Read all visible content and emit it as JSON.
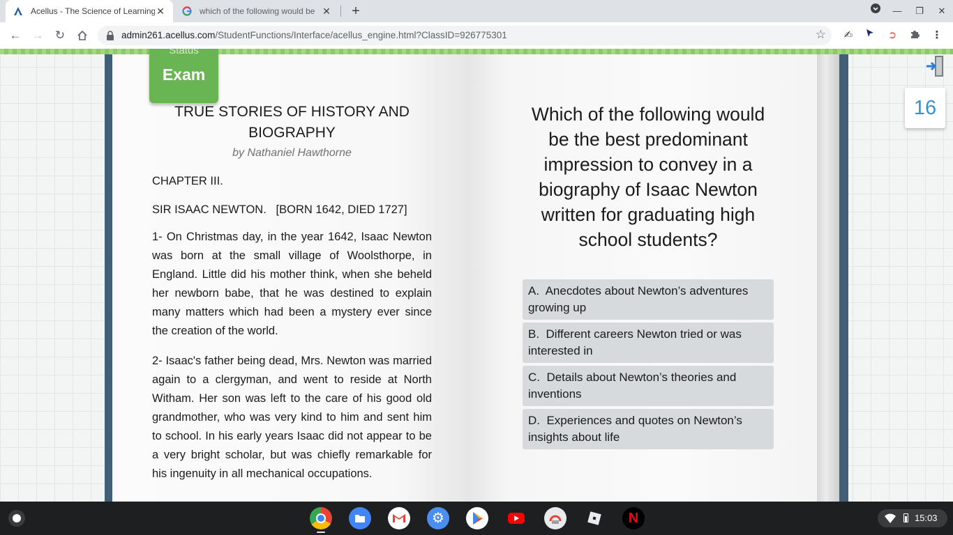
{
  "browser": {
    "tabs": [
      {
        "title": "Acellus - The Science of Learning",
        "favicon": "acellus-logo-icon",
        "active": true
      },
      {
        "title": "which of the following would be",
        "favicon": "google-g-icon",
        "active": false
      }
    ],
    "address": {
      "domain": "admin261.acellus.com",
      "path": "/StudentFunctions/Interface/acellus_engine.html?ClassID=926775301"
    }
  },
  "lesson": {
    "status_label": "Status",
    "mode_label": "Exam",
    "book_title": "TRUE STORIES OF HISTORY AND BIOGRAPHY",
    "byline": "by Nathaniel Hawthorne",
    "chapter": "CHAPTER III.",
    "subject": "SIR ISAAC NEWTON.   [BORN 1642, DIED 1727]",
    "paragraphs": [
      "1-   On Christmas day, in the year 1642, Isaac Newton was born at the small village of Woolsthorpe, in England.  Little did his mother think, when she beheld her newborn babe, that he was destined to explain many matters which had been a mystery ever since the creation of the world.",
      "2-   Isaac's father being dead, Mrs. Newton was married again to a clergyman, and went to reside at North Witham.  Her son was left to the care of his good old grandmother, who was very kind to him and sent him to school. In his early years Isaac did not appear to be a very bright scholar, but was chiefly remarkable for his ingenuity in all mechanical occupations."
    ],
    "question": "Which of the following would be the best predominant impression to convey in a biography of Isaac Newton written for graduating high school students?",
    "options": [
      {
        "letter": "A.",
        "text": "Anecdotes about Newton’s adventures growing up"
      },
      {
        "letter": "B.",
        "text": "Different careers Newton tried or was interested in"
      },
      {
        "letter": "C.",
        "text": "Details about Newton’s theories and inventions"
      },
      {
        "letter": "D.",
        "text": "Experiences and quotes on Newton’s insights about life"
      }
    ],
    "question_counter": "16"
  },
  "shelf": {
    "apps": [
      "chrome-icon",
      "files-icon",
      "gmail-icon",
      "settings-icon",
      "play-store-icon",
      "youtube-icon",
      "chrome-remote-icon",
      "roblox-icon",
      "netflix-icon"
    ],
    "time": "15:03"
  },
  "colors": {
    "accent_green": "#6ab553",
    "book_border": "#415f78",
    "option_bg": "#d7dadd",
    "counter_blue": "#3a8fcf"
  }
}
